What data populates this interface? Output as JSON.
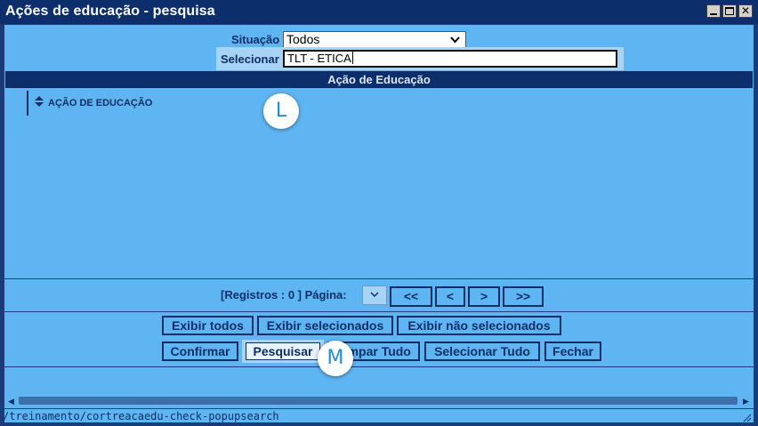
{
  "window": {
    "title": "Ações de educação - pesquisa"
  },
  "form": {
    "situacao_label": "Situação",
    "situacao_value": "Todos",
    "selecionar_label": "Selecionar",
    "selecionar_value": "TLT - ETICA"
  },
  "grid": {
    "header": "Ação de Educação",
    "column_label": "AÇÃO DE EDUCAÇÃO"
  },
  "pager": {
    "text": "[Registros : 0 ] Página:",
    "page_select": "",
    "first": "<<",
    "prev": "<",
    "next": ">",
    "last": ">>"
  },
  "actions": {
    "exibir_todos": "Exibir todos",
    "exibir_selecionados": "Exibir selecionados",
    "exibir_nao_selecionados": "Exibir não selecionados",
    "confirmar": "Confirmar",
    "pesquisar": "Pesquisar",
    "limpar_tudo": "Limpar Tudo",
    "selecionar_tudo": "Selecionar Tudo",
    "fechar": "Fechar"
  },
  "markers": {
    "l": "L",
    "m": "M"
  },
  "status": {
    "url": "/treinamento/cortreacaedu-check-popupsearch"
  },
  "colors": {
    "titlebar": "#0c2f6c",
    "client_bg": "#5eb5f2",
    "text_dark": "#0d2f66",
    "marker_text": "#1f8fd6"
  }
}
